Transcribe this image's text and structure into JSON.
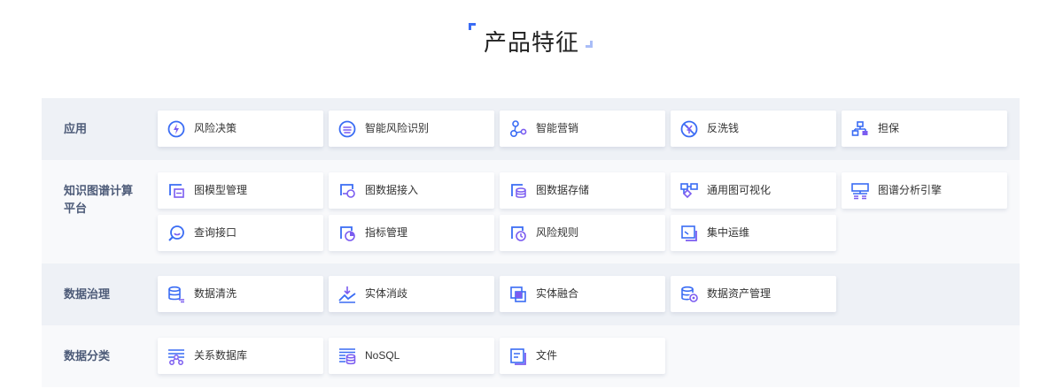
{
  "header": {
    "title": "产品特征"
  },
  "colors": {
    "accent": "#3a6cf4",
    "accent_light": "#a9bdf7",
    "purple": "#7b5cf0",
    "label": "#4d5b78"
  },
  "rows": [
    {
      "label": "应用",
      "items": [
        {
          "label": "风险决策",
          "icon": "lightning-circle-icon"
        },
        {
          "label": "智能风险识别",
          "icon": "scan-circle-icon"
        },
        {
          "label": "智能营销",
          "icon": "nodes-icon"
        },
        {
          "label": "反洗钱",
          "icon": "no-money-icon"
        },
        {
          "label": "担保",
          "icon": "hierarchy-icon"
        }
      ]
    },
    {
      "label": "知识图谱计算平台",
      "items": [
        {
          "label": "图模型管理",
          "icon": "model-icon"
        },
        {
          "label": "图数据接入",
          "icon": "data-access-icon"
        },
        {
          "label": "图数据存储",
          "icon": "storage-icon"
        },
        {
          "label": "通用图可视化",
          "icon": "graph-visual-icon"
        },
        {
          "label": "图谱分析引擎",
          "icon": "engine-icon"
        },
        {
          "label": "查询接口",
          "icon": "query-icon"
        },
        {
          "label": "指标管理",
          "icon": "metric-icon"
        },
        {
          "label": "风险规则",
          "icon": "rule-icon"
        },
        {
          "label": "集中运维",
          "icon": "ops-icon"
        }
      ]
    },
    {
      "label": "数据治理",
      "items": [
        {
          "label": "数据清洗",
          "icon": "db-clean-icon"
        },
        {
          "label": "实体消歧",
          "icon": "entity-disambig-icon"
        },
        {
          "label": "实体融合",
          "icon": "entity-merge-icon"
        },
        {
          "label": "数据资产管理",
          "icon": "db-gear-icon"
        }
      ]
    },
    {
      "label": "数据分类",
      "items": [
        {
          "label": "关系数据库",
          "icon": "relational-db-icon"
        },
        {
          "label": "NoSQL",
          "icon": "nosql-icon"
        },
        {
          "label": "文件",
          "icon": "file-icon"
        }
      ]
    }
  ]
}
